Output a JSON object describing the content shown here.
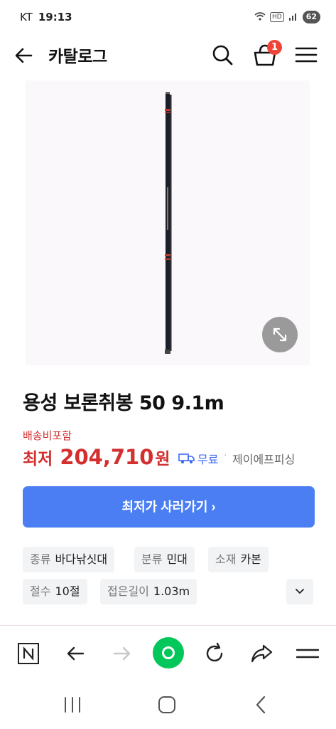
{
  "status_bar": {
    "carrier": "KT",
    "time": "19:13",
    "hd": "HD",
    "battery": "62"
  },
  "header": {
    "title": "카탈로그",
    "cart_count": "1"
  },
  "product": {
    "title": "용성 보론취봉 50 9.1m",
    "shipping_note": "배송비포함",
    "price_label": "최저",
    "price": "204,710",
    "price_unit": "원",
    "shipping": "무료",
    "separator": "·",
    "seller": "제이에프피싱",
    "buy_button": "최저가 사러가기 ›"
  },
  "specs": [
    {
      "key": "종류",
      "value": "바다낚싯대"
    },
    {
      "key": "분류",
      "value": "민대"
    },
    {
      "key": "소재",
      "value": "카본"
    },
    {
      "key": "절수",
      "value": "10절"
    },
    {
      "key": "접은길이",
      "value": "1.03m"
    }
  ],
  "colors": {
    "price_red": "#d32f2f",
    "accent_blue": "#4a7ef2",
    "naver_green": "#03c75a"
  },
  "icons": {
    "header": [
      "back-arrow-icon",
      "search-icon",
      "cart-icon",
      "menu-icon"
    ],
    "browser": [
      "naver-n-icon",
      "back-arrow-icon",
      "forward-arrow-icon",
      "green-home-icon",
      "refresh-icon",
      "share-icon",
      "menu-icon"
    ],
    "system": [
      "recent-apps-icon",
      "home-icon",
      "back-icon"
    ]
  }
}
